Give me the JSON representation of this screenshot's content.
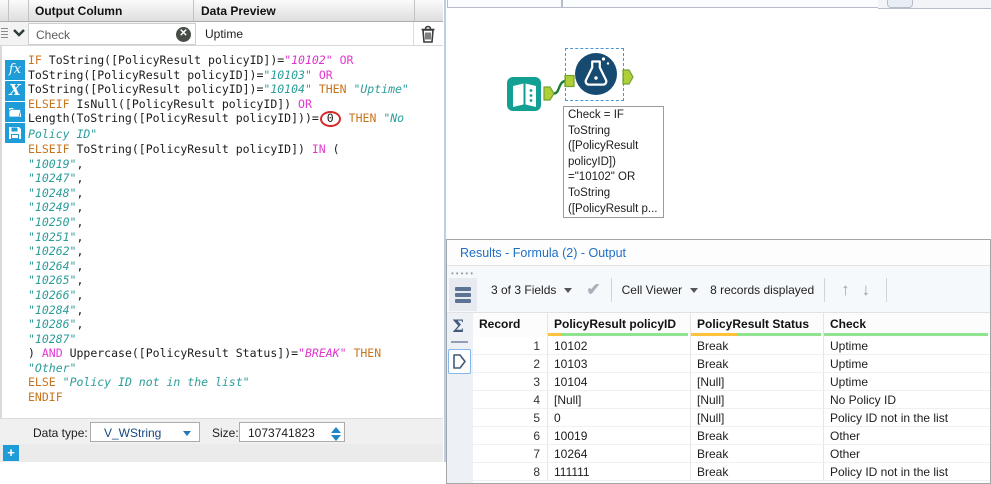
{
  "panel_left": {
    "header": {
      "output_column": "Output Column",
      "data_preview": "Data Preview"
    },
    "expression_row": {
      "name_value": "Check",
      "preview_value": "Uptime"
    },
    "code_lines": [
      [
        {
          "t": "IF ",
          "c": "kw"
        },
        {
          "t": "ToString([PolicyResult policyID])=",
          "c": "pl"
        },
        {
          "t": "\"10102\"",
          "c": "ms"
        },
        {
          "t": " ",
          "c": "pl"
        },
        {
          "t": "OR",
          "c": "op"
        }
      ],
      [
        {
          "t": "ToString([PolicyResult policyID])=",
          "c": "pl"
        },
        {
          "t": "\"10103\"",
          "c": "s"
        },
        {
          "t": " ",
          "c": "pl"
        },
        {
          "t": "OR",
          "c": "op"
        }
      ],
      [
        {
          "t": "ToString([PolicyResult policyID])=",
          "c": "pl"
        },
        {
          "t": "\"10104\"",
          "c": "s"
        },
        {
          "t": " ",
          "c": "pl"
        },
        {
          "t": "THEN",
          "c": "kw"
        },
        {
          "t": " ",
          "c": "pl"
        },
        {
          "t": "\"Uptime\"",
          "c": "s"
        }
      ],
      [
        {
          "t": "ELSEIF",
          "c": "kw"
        },
        {
          "t": " IsNull([PolicyResult policyID]) ",
          "c": "pl"
        },
        {
          "t": "OR",
          "c": "op"
        }
      ],
      [
        {
          "t": "Length(ToString([PolicyResult policyID]))=",
          "c": "pl"
        },
        {
          "t": "0",
          "c": "circ"
        },
        {
          "t": " ",
          "c": "pl"
        },
        {
          "t": "THEN",
          "c": "kw"
        },
        {
          "t": " ",
          "c": "pl"
        },
        {
          "t": "\"No",
          "c": "s"
        }
      ],
      [
        {
          "t": "Policy ID\"",
          "c": "s"
        }
      ],
      [
        {
          "t": "ELSEIF",
          "c": "kw"
        },
        {
          "t": " ToString([PolicyResult policyID]) ",
          "c": "pl"
        },
        {
          "t": "IN",
          "c": "op"
        },
        {
          "t": " (",
          "c": "pl"
        }
      ],
      [
        {
          "t": "\"10019\"",
          "c": "s"
        },
        {
          "t": ",",
          "c": "pl"
        }
      ],
      [
        {
          "t": "\"10247\"",
          "c": "s"
        },
        {
          "t": ",",
          "c": "pl"
        }
      ],
      [
        {
          "t": "\"10248\"",
          "c": "s"
        },
        {
          "t": ",",
          "c": "pl"
        }
      ],
      [
        {
          "t": "\"10249\"",
          "c": "s"
        },
        {
          "t": ",",
          "c": "pl"
        }
      ],
      [
        {
          "t": "\"10250\"",
          "c": "s"
        },
        {
          "t": ",",
          "c": "pl"
        }
      ],
      [
        {
          "t": "\"10251\"",
          "c": "s"
        },
        {
          "t": ",",
          "c": "pl"
        }
      ],
      [
        {
          "t": "\"10262\"",
          "c": "s"
        },
        {
          "t": ",",
          "c": "pl"
        }
      ],
      [
        {
          "t": "\"10264\"",
          "c": "s"
        },
        {
          "t": ",",
          "c": "pl"
        }
      ],
      [
        {
          "t": "\"10265\"",
          "c": "s"
        },
        {
          "t": ",",
          "c": "pl"
        }
      ],
      [
        {
          "t": "\"10266\"",
          "c": "s"
        },
        {
          "t": ",",
          "c": "pl"
        }
      ],
      [
        {
          "t": "\"10284\"",
          "c": "s"
        },
        {
          "t": ",",
          "c": "pl"
        }
      ],
      [
        {
          "t": "\"10286\"",
          "c": "s"
        },
        {
          "t": ",",
          "c": "pl"
        }
      ],
      [
        {
          "t": "\"10287\"",
          "c": "s"
        }
      ],
      [
        {
          "t": ") ",
          "c": "pl"
        },
        {
          "t": "AND",
          "c": "op"
        },
        {
          "t": " Uppercase([PolicyResult Status])=",
          "c": "pl"
        },
        {
          "t": "\"BREAK\"",
          "c": "ms"
        },
        {
          "t": " ",
          "c": "pl"
        },
        {
          "t": "THEN",
          "c": "kw"
        }
      ],
      [
        {
          "t": "\"Other\"",
          "c": "s"
        }
      ],
      [
        {
          "t": "ELSE",
          "c": "kw"
        },
        {
          "t": " ",
          "c": "pl"
        },
        {
          "t": "\"Policy ID not in the list\"",
          "c": "s"
        }
      ],
      [
        {
          "t": "ENDIF",
          "c": "kw"
        }
      ]
    ],
    "footer": {
      "data_type_label": "Data type:",
      "data_type_value": "V_WString",
      "size_label": "Size:",
      "size_value": "1073741823"
    },
    "add_button_label": "+"
  },
  "canvas": {
    "tooltip_lines": [
      "Check = IF",
      "ToString",
      "([PolicyResult",
      "policyID])",
      "=\"10102\" OR",
      "ToString",
      "([PolicyResult p..."
    ]
  },
  "results": {
    "title": "Results - Formula (2) - Output",
    "toolbar": {
      "fields": "3 of 3 Fields",
      "cell_viewer": "Cell Viewer",
      "records": "8 records displayed",
      "check_glyph": "✔",
      "up_glyph": "↑",
      "down_glyph": "↓"
    },
    "table": {
      "columns": [
        "Record",
        "PolicyResult policyID",
        "PolicyResult Status",
        "Check"
      ],
      "rows": [
        [
          "1",
          "10102",
          "Break",
          "Uptime"
        ],
        [
          "2",
          "10103",
          "Break",
          "Uptime"
        ],
        [
          "3",
          "10104",
          "[Null]",
          "Uptime"
        ],
        [
          "4",
          "[Null]",
          "[Null]",
          "No Policy ID"
        ],
        [
          "5",
          "0",
          "[Null]",
          "Policy ID not in the list"
        ],
        [
          "6",
          "10019",
          "Break",
          "Other"
        ],
        [
          "7",
          "10264",
          "Break",
          "Other"
        ],
        [
          "8",
          "111111",
          "Break",
          "Policy ID not in the list"
        ]
      ]
    }
  },
  "colors": {
    "accent_blue": "#1E9CD7",
    "tool_teal": "#11A091",
    "tool_navy": "#174A70",
    "anchor_green": "#AECF38",
    "wire_green": "#1E7C36",
    "title_blue": "#1F6FC5",
    "underline_green": "#8FE38F",
    "underline_orange": "#FFC23D"
  }
}
